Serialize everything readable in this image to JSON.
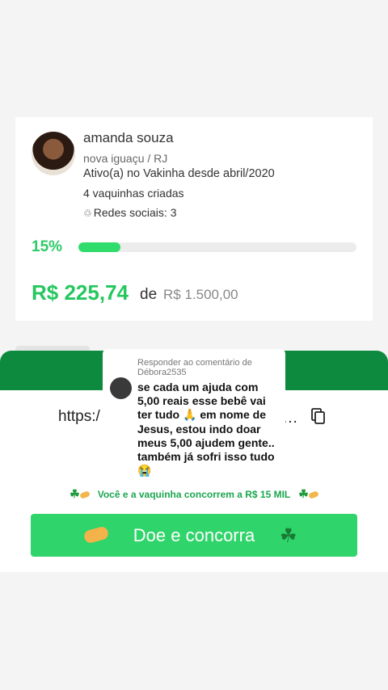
{
  "profile": {
    "name": "amanda souza",
    "location": "nova iguaçu / RJ",
    "active_since": "Ativo(a) no Vakinha desde abril/2020",
    "created_count": "4 vaquinhas criadas",
    "social": "Redes sociais: 3"
  },
  "progress": {
    "percent_label": "15%",
    "fraction": 0.15,
    "raised": "R$ 225,74",
    "of": "de",
    "goal": "R$ 1.500,00"
  },
  "share": {
    "url": "https:/",
    "ellipsis": "...",
    "copy_icon": "copy-icon"
  },
  "promo": {
    "text": "Você e a vaquinha concorrem a R$ 15 MIL"
  },
  "cta": {
    "label": "Doe e concorra"
  },
  "comment_overlay": {
    "reply_to": "Responder ao comentário de Débora2535",
    "text": "se cada um ajuda com 5,00 reais esse bebê vai ter tudo 🙏 em nome de Jesus, estou indo doar meus 5,00 ajudem gente.. também já sofri isso tudo 😭"
  },
  "colors": {
    "accent_green": "#2fd46a",
    "dark_green": "#0d8a3e",
    "amount_green": "#26c75f"
  }
}
